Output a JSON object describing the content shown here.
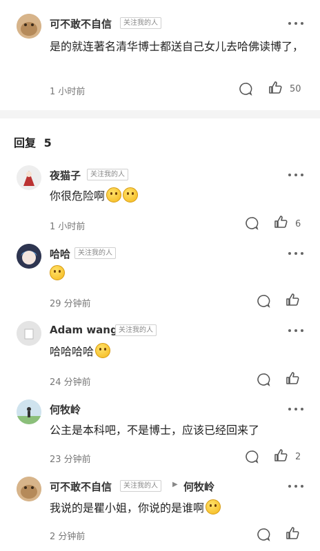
{
  "top_comment": {
    "username": "可不敢不自信",
    "follow_label": "关注我的人",
    "text": "是的就连著名清华博士都送自己女儿去哈佛读博了，",
    "time": "1 小时前",
    "likes": "50"
  },
  "replies_header": {
    "label": "回复",
    "count": "5"
  },
  "replies": [
    {
      "username": "夜猫子",
      "follow_label": "关注我的人",
      "text": "你很危险啊",
      "time": "1 小时前",
      "likes": "6"
    },
    {
      "username": "哈哈",
      "follow_label": "关注我的人",
      "text": "",
      "time": "29 分钟前",
      "likes": ""
    },
    {
      "username": "Adam wang",
      "follow_label": "关注我的人",
      "text": "哈哈哈哈",
      "time": "24 分钟前",
      "likes": ""
    },
    {
      "username": "何牧岭",
      "follow_label": "",
      "text": "公主是本科吧，不是博士，应该已经回来了",
      "time": "23 分钟前",
      "likes": "2"
    },
    {
      "username": "可不敢不自信",
      "follow_label": "关注我的人",
      "reply_to": "何牧岭",
      "text": "我说的是瞿小姐，你说的是谁啊",
      "time": "2 分钟前",
      "likes": ""
    }
  ]
}
